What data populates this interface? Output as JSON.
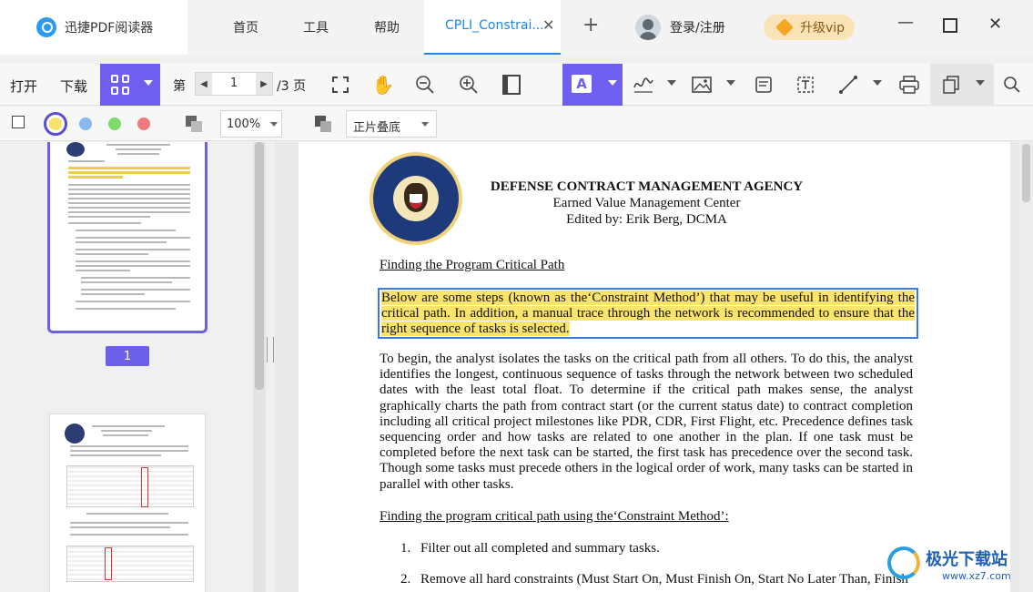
{
  "app": {
    "name": "迅捷PDF阅读器",
    "nav_tabs": [
      "首页",
      "工具",
      "帮助"
    ],
    "doc_tab": "CPLI_Constrai...",
    "login": "登录/注册",
    "vip": "升级vip"
  },
  "toolbar": {
    "open": "打开",
    "download": "下载",
    "page_prefix": "第",
    "page_current": "1",
    "page_total": "/3 页"
  },
  "subbar": {
    "zoom": "100%",
    "blend_mode": "正片叠底",
    "colors": [
      "#f5e36a",
      "#8ab8f0",
      "#7fdc6a",
      "#f07a7a"
    ]
  },
  "sidebar": {
    "page_badge": "1"
  },
  "document": {
    "agency_title": "DEFENSE CONTRACT MANAGEMENT AGENCY",
    "center": "Earned Value Management Center",
    "editor": "Edited by: Erik Berg, DCMA",
    "heading1": "Finding the Program Critical Path",
    "highlight": "Below are some steps (known as the‘Constraint Method’) that may be useful in identifying the critical path. In addition, a manual trace through the network is recommended to ensure that the right sequence of tasks is selected.",
    "paragraph": "To begin, the analyst isolates the tasks on the critical path from all others. To do this, the analyst identifies the longest, continuous sequence of tasks through the network between two scheduled dates with the least total float. To determine if the critical path makes sense, the analyst graphically charts the path from contract start (or the current status date) to contract completion including all critical project milestones like PDR, CDR, First Flight, etc. Precedence defines task sequencing order and how tasks are related to one another in the plan. If one task must be completed before the next task can be started, the first task has precedence over the second task. Though some tasks must precede others in the logical order of work, many tasks can be started in parallel with other tasks.",
    "heading2": "Finding the program critical path using the‘Constraint Method’:",
    "list": [
      {
        "num": "1.",
        "text": "Filter out all completed and summary tasks."
      },
      {
        "num": "2.",
        "text": "Remove all hard constraints (Must Start On, Must Finish On, Start No Later Than, Finish"
      }
    ]
  },
  "watermark": {
    "title": "极光下载站",
    "url": "www.xz7.com"
  }
}
